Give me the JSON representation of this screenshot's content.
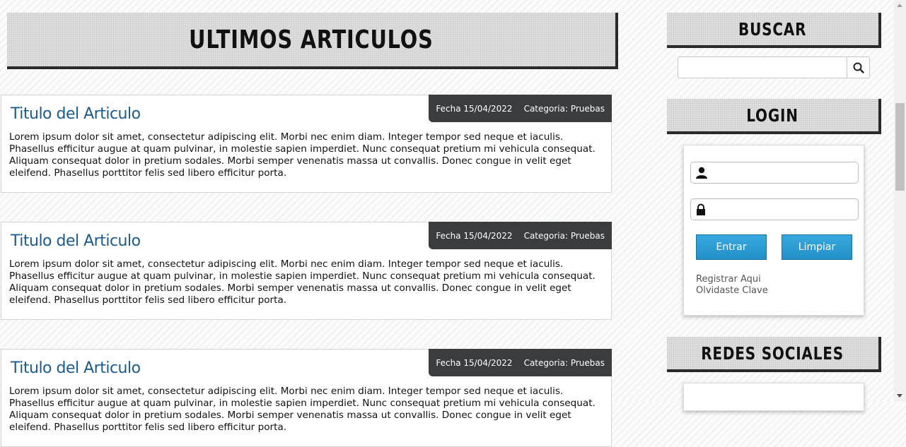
{
  "main": {
    "heading": "ULTIMOS ARTICULOS",
    "articles": [
      {
        "title": "Titulo del Articulo",
        "date": "Fecha 15/04/2022",
        "category": "Categoria: Pruebas",
        "body": "Lorem ipsum dolor sit amet, consectetur adipiscing elit. Morbi nec enim diam. Integer tempor sed neque et iaculis. Phasellus efficitur augue at quam pulvinar, in molestie sapien imperdiet. Nunc consequat pretium mi vehicula consequat. Aliquam consequat dolor in pretium sodales. Morbi semper venenatis massa ut convallis. Donec congue in velit eget eleifend. Phasellus porttitor felis sed libero efficitur porta."
      },
      {
        "title": "Titulo del Articulo",
        "date": "Fecha 15/04/2022",
        "category": "Categoria: Pruebas",
        "body": "Lorem ipsum dolor sit amet, consectetur adipiscing elit. Morbi nec enim diam. Integer tempor sed neque et iaculis. Phasellus efficitur augue at quam pulvinar, in molestie sapien imperdiet. Nunc consequat pretium mi vehicula consequat. Aliquam consequat dolor in pretium sodales. Morbi semper venenatis massa ut convallis. Donec congue in velit eget eleifend. Phasellus porttitor felis sed libero efficitur porta."
      },
      {
        "title": "Titulo del Articulo",
        "date": "Fecha 15/04/2022",
        "category": "Categoria: Pruebas",
        "body": "Lorem ipsum dolor sit amet, consectetur adipiscing elit. Morbi nec enim diam. Integer tempor sed neque et iaculis. Phasellus efficitur augue at quam pulvinar, in molestie sapien imperdiet. Nunc consequat pretium mi vehicula consequat. Aliquam consequat dolor in pretium sodales. Morbi semper venenatis massa ut convallis. Donec congue in velit eget eleifend. Phasellus porttitor felis sed libero efficitur porta."
      }
    ]
  },
  "sidebar": {
    "search": {
      "heading": "BUSCAR",
      "value": "",
      "button_icon": "search-icon"
    },
    "login": {
      "heading": "LOGIN",
      "user_value": "",
      "user_icon": "user-icon",
      "password_value": "",
      "password_icon": "lock-icon",
      "submit_label": "Entrar",
      "clear_label": "Limpiar",
      "register_link": "Registrar Aqui",
      "forgot_link": "Olvidaste Clave"
    },
    "social": {
      "heading": "REDES SOCIALES"
    }
  }
}
